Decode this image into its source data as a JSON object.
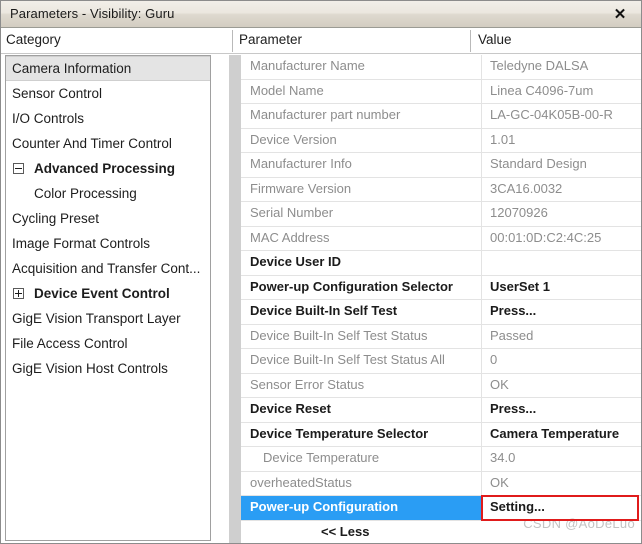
{
  "window": {
    "title": "Parameters - Visibility: Guru",
    "close_label": "✕"
  },
  "columns": {
    "category": "Category",
    "parameter": "Parameter",
    "value": "Value"
  },
  "sidebar": {
    "items": [
      {
        "label": "Camera Information",
        "state": "selected",
        "indent": 0,
        "toggle": ""
      },
      {
        "label": "Sensor Control",
        "state": "normal",
        "indent": 0,
        "toggle": ""
      },
      {
        "label": "I/O Controls",
        "state": "normal",
        "indent": 0,
        "toggle": ""
      },
      {
        "label": "Counter And Timer Control",
        "state": "normal",
        "indent": 0,
        "toggle": ""
      },
      {
        "label": "Advanced Processing",
        "state": "bold",
        "indent": 0,
        "toggle": "minus"
      },
      {
        "label": "Color Processing",
        "state": "child",
        "indent": 1,
        "toggle": ""
      },
      {
        "label": "Cycling Preset",
        "state": "normal",
        "indent": 0,
        "toggle": ""
      },
      {
        "label": "Image Format Controls",
        "state": "normal",
        "indent": 0,
        "toggle": ""
      },
      {
        "label": "Acquisition and Transfer Cont...",
        "state": "normal",
        "indent": 0,
        "toggle": ""
      },
      {
        "label": "Device Event Control",
        "state": "bold",
        "indent": 0,
        "toggle": "plus"
      },
      {
        "label": "GigE Vision Transport Layer",
        "state": "normal",
        "indent": 0,
        "toggle": ""
      },
      {
        "label": "File Access Control",
        "state": "normal",
        "indent": 0,
        "toggle": ""
      },
      {
        "label": "GigE Vision Host Controls",
        "state": "normal",
        "indent": 0,
        "toggle": ""
      }
    ]
  },
  "parameters": {
    "rows": [
      {
        "name": "Manufacturer Name",
        "value": "Teledyne DALSA",
        "mode": "readonly",
        "indent": false
      },
      {
        "name": "Model Name",
        "value": "Linea C4096-7um",
        "mode": "readonly",
        "indent": false
      },
      {
        "name": "Manufacturer part number",
        "value": "LA-GC-04K05B-00-R",
        "mode": "readonly",
        "indent": false
      },
      {
        "name": "Device Version",
        "value": "1.01",
        "mode": "readonly",
        "indent": false
      },
      {
        "name": "Manufacturer Info",
        "value": "Standard Design",
        "mode": "readonly",
        "indent": false
      },
      {
        "name": "Firmware Version",
        "value": "3CA16.0032",
        "mode": "readonly",
        "indent": false
      },
      {
        "name": "Serial Number",
        "value": "12070926",
        "mode": "readonly",
        "indent": false
      },
      {
        "name": "MAC Address",
        "value": "00:01:0D:C2:4C:25",
        "mode": "readonly",
        "indent": false
      },
      {
        "name": "Device User ID",
        "value": "",
        "mode": "editable",
        "indent": false
      },
      {
        "name": "Power-up Configuration Selector",
        "value": "UserSet 1",
        "mode": "editable",
        "indent": false
      },
      {
        "name": "Device Built-In Self Test",
        "value": "Press...",
        "mode": "editable",
        "indent": false
      },
      {
        "name": "Device Built-In Self Test Status",
        "value": "Passed",
        "mode": "readonly",
        "indent": false
      },
      {
        "name": "Device Built-In Self Test Status All",
        "value": "0",
        "mode": "readonly",
        "indent": false
      },
      {
        "name": "Sensor Error Status",
        "value": "OK",
        "mode": "readonly",
        "indent": false
      },
      {
        "name": "Device Reset",
        "value": "Press...",
        "mode": "editable",
        "indent": false
      },
      {
        "name": "Device Temperature Selector",
        "value": "Camera Temperature",
        "mode": "editable",
        "indent": false
      },
      {
        "name": "Device Temperature",
        "value": "34.0",
        "mode": "readonly",
        "indent": true
      },
      {
        "name": "overheatedStatus",
        "value": "OK",
        "mode": "readonly",
        "indent": false
      },
      {
        "name": "Power-up Configuration",
        "value": "Setting...",
        "mode": "selected",
        "indent": false
      }
    ],
    "less_label": "<< Less",
    "watermark": "CSDN @AoDeLuo"
  },
  "colors": {
    "selection_blue": "#2a9df4",
    "highlight_red": "#e01b1b",
    "readonly_text": "#8d8d8d",
    "active_text": "#1b1b1b"
  }
}
